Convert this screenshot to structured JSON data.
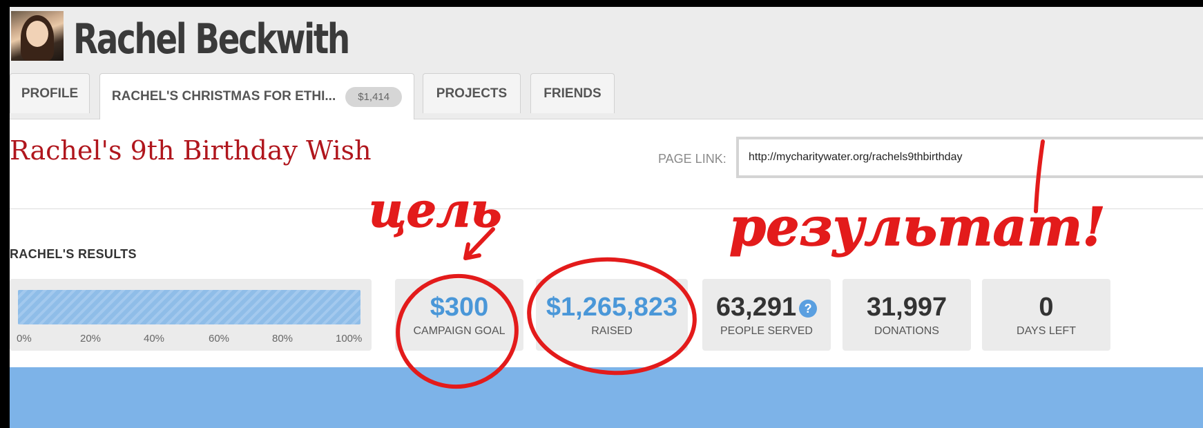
{
  "profile": {
    "name": "Rachel Beckwith"
  },
  "tabs": [
    {
      "label": "PROFILE"
    },
    {
      "label": "RACHEL'S CHRISTMAS FOR ETHI...",
      "badge": "$1,414"
    },
    {
      "label": "PROJECTS"
    },
    {
      "label": "FRIENDS"
    }
  ],
  "campaign": {
    "title": "Rachel's 9th Birthday Wish",
    "page_link_label": "PAGE LINK:",
    "page_link_value": "http://mycharitywater.org/rachels9thbirthday"
  },
  "results": {
    "heading": "RACHEL'S RESULTS",
    "progress_fraction": 1.0,
    "progress_ticks": [
      "0%",
      "20%",
      "40%",
      "60%",
      "80%",
      "100%"
    ],
    "stats": [
      {
        "value": "$300",
        "label": "CAMPAIGN GOAL"
      },
      {
        "value": "$1,265,823",
        "label": "RAISED"
      },
      {
        "value": "63,291",
        "label": "PEOPLE SERVED",
        "icon": "question-icon",
        "icon_glyph": "?"
      },
      {
        "value": "31,997",
        "label": "DONATIONS"
      },
      {
        "value": "0",
        "label": "DAYS LEFT"
      }
    ]
  },
  "annotations": {
    "left_word": "цель",
    "right_word": "результат!",
    "ink_color": "#e31b1b"
  }
}
